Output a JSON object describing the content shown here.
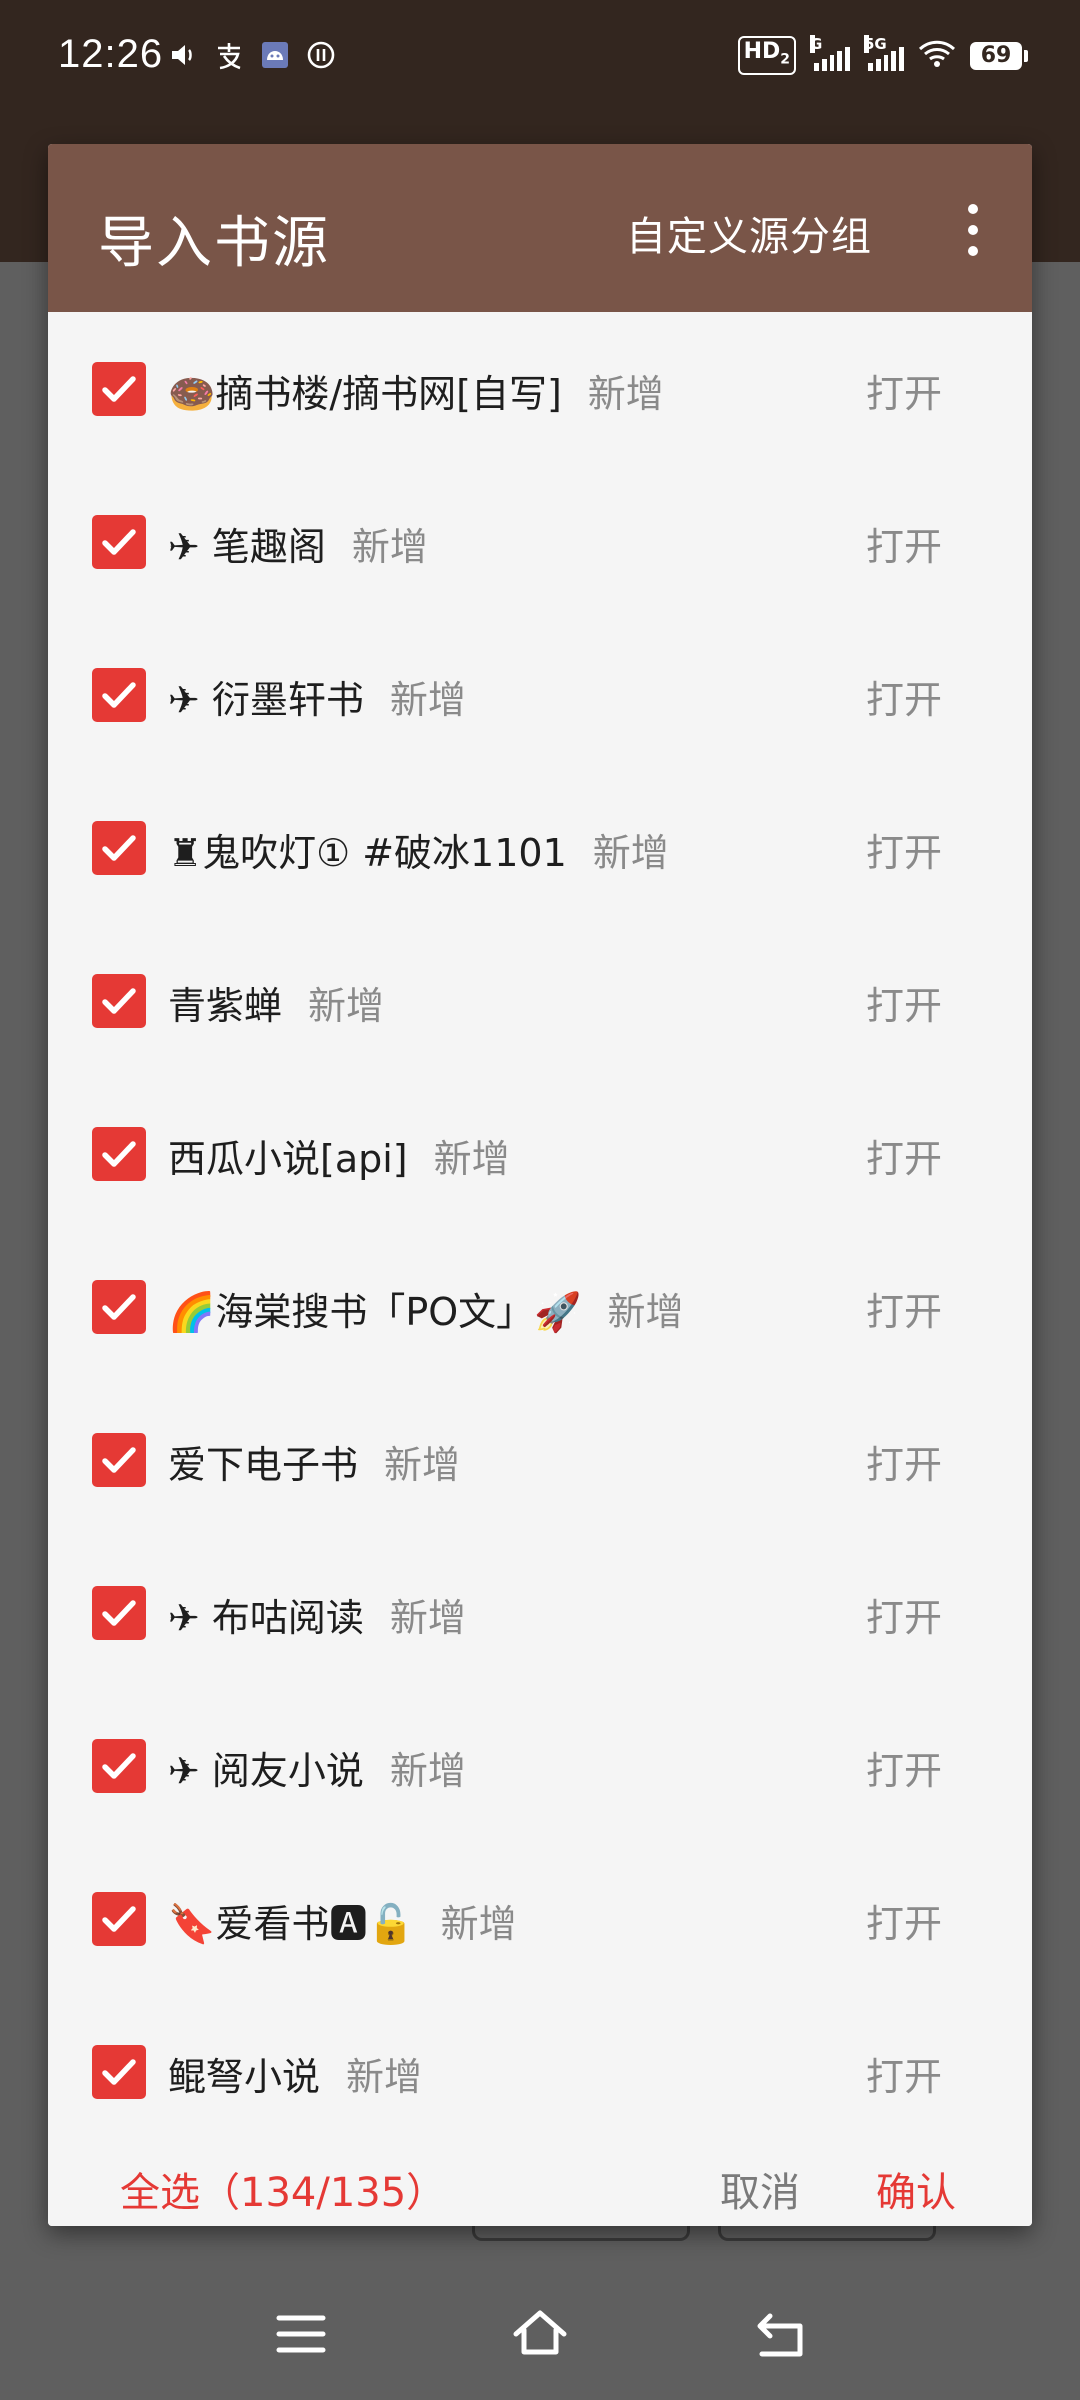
{
  "status_bar": {
    "time": "12:26",
    "left_icons": [
      "volume-icon",
      "alipay-icon",
      "android-icon",
      "notification-icon"
    ],
    "network": "HD",
    "network_sub": "2",
    "signal1_label": "G",
    "signal2_label": "5G",
    "battery": "69"
  },
  "dialog": {
    "title": "导入书源",
    "group_button": "自定义源分组",
    "open_label": "打开",
    "items": [
      {
        "name": "🍩摘书楼/摘书网[自写]",
        "tag": "新增",
        "checked": true
      },
      {
        "name": "✈ 笔趣阁",
        "tag": "新增",
        "checked": true
      },
      {
        "name": "✈ 衍墨轩书",
        "tag": "新增",
        "checked": true
      },
      {
        "name": "♜鬼吹灯① #破冰1101",
        "tag": "新增",
        "checked": true
      },
      {
        "name": "青紫蝉",
        "tag": "新增",
        "checked": true
      },
      {
        "name": "西瓜小说[api]",
        "tag": "新增",
        "checked": true
      },
      {
        "name": "🌈海棠搜书「PO文」🚀",
        "tag": "新增",
        "checked": true
      },
      {
        "name": "爱下电子书",
        "tag": "新增",
        "checked": true
      },
      {
        "name": "✈ 布咕阅读",
        "tag": "新增",
        "checked": true
      },
      {
        "name": "✈ 阅友小说",
        "tag": "新增",
        "checked": true
      },
      {
        "name": "🔖爱看书🅰🔓",
        "tag": "新增",
        "checked": true
      },
      {
        "name": "鲲弩小说",
        "tag": "新增",
        "checked": true
      }
    ],
    "footer": {
      "select_all": "全选（134/135）",
      "cancel": "取消",
      "confirm": "确认"
    }
  },
  "colors": {
    "toolbar": "#795548",
    "accent": "#e53935",
    "app_bar_dark": "#33261f"
  }
}
